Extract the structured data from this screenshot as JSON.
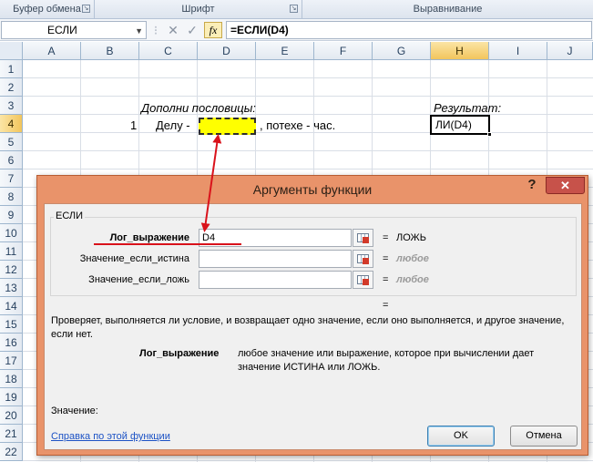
{
  "ribbon": {
    "groups": [
      "Буфер обмена",
      "Шрифт",
      "Выравнивание"
    ],
    "launcher_icon": "dialog-launcher-icon"
  },
  "formula_bar": {
    "name_box": "ЕСЛИ",
    "cancel_icon": "✕",
    "enter_icon": "✓",
    "fx_label": "fx",
    "formula": "=ЕСЛИ(D4)"
  },
  "grid": {
    "columns": [
      "A",
      "B",
      "C",
      "D",
      "E",
      "F",
      "G",
      "H",
      "I",
      "J"
    ],
    "rows": [
      "1",
      "2",
      "3",
      "4",
      "5",
      "6",
      "7",
      "8",
      "9",
      "10",
      "11",
      "12",
      "13",
      "14",
      "15",
      "16",
      "17",
      "18",
      "19",
      "20",
      "21",
      "22"
    ],
    "selected_column": "H",
    "selected_row": "4",
    "cells": {
      "c3": "Дополни пословицы:",
      "h3": "Результат:",
      "b4": "1",
      "c4": "Делу -",
      "e4": ", потехе - час.",
      "h4": "ЛИ(D4)"
    },
    "highlight_color": "#ffff00"
  },
  "dialog": {
    "title": "Аргументы функции",
    "help_icon": "?",
    "close_icon": "✕",
    "function_name": "ЕСЛИ",
    "args": [
      {
        "label": "Лог_выражение",
        "value": "D4",
        "result": "ЛОЖЬ"
      },
      {
        "label": "Значение_если_истина",
        "value": "",
        "result": "любое"
      },
      {
        "label": "Значение_если_ложь",
        "value": "",
        "result": "любое"
      }
    ],
    "eq_sign": "=",
    "description": "Проверяет, выполняется ли условие, и возвращает одно значение, если оно выполняется, и другое значение, если нет.",
    "arg_description_name": "Лог_выражение",
    "arg_description_text": "любое значение или выражение, которое при вычислении дает значение ИСТИНА или ЛОЖЬ.",
    "value_label": "Значение:",
    "help_link": "Справка по этой функции",
    "ok_label": "OK",
    "cancel_label": "Отмена",
    "title_color": "#e9936a"
  },
  "annotation": {
    "color": "#d9121b"
  }
}
